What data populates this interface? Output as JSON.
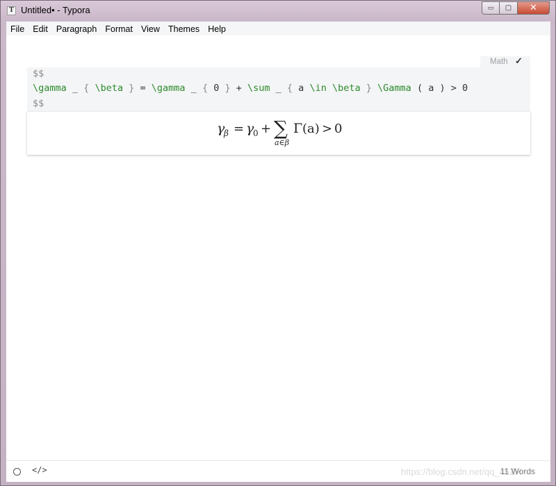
{
  "window": {
    "app_icon": "T",
    "title": "Untitled• - Typora",
    "controls": {
      "minimize": "▭",
      "maximize": "▢",
      "close": "✕"
    }
  },
  "menubar": {
    "items": [
      "File",
      "Edit",
      "Paragraph",
      "Format",
      "View",
      "Themes",
      "Help"
    ]
  },
  "editor": {
    "math_block": {
      "tag_label": "Math",
      "tag_check": "✓",
      "open_delimiter": "$$",
      "close_delimiter": "$$",
      "source_tokens": [
        {
          "t": "\\gamma",
          "k": "cmd"
        },
        {
          "t": " _ ",
          "k": "text"
        },
        {
          "t": "{",
          "k": "brace"
        },
        {
          "t": " ",
          "k": "text"
        },
        {
          "t": "\\beta",
          "k": "cmd"
        },
        {
          "t": " ",
          "k": "text"
        },
        {
          "t": "}",
          "k": "brace"
        },
        {
          "t": " = ",
          "k": "text"
        },
        {
          "t": "\\gamma",
          "k": "cmd"
        },
        {
          "t": " _ ",
          "k": "text"
        },
        {
          "t": "{",
          "k": "brace"
        },
        {
          "t": " 0 ",
          "k": "text"
        },
        {
          "t": "}",
          "k": "brace"
        },
        {
          "t": " + ",
          "k": "text"
        },
        {
          "t": "\\sum",
          "k": "cmd"
        },
        {
          "t": " _ ",
          "k": "text"
        },
        {
          "t": "{",
          "k": "brace"
        },
        {
          "t": " a ",
          "k": "text"
        },
        {
          "t": "\\in",
          "k": "cmd"
        },
        {
          "t": " ",
          "k": "text"
        },
        {
          "t": "\\beta",
          "k": "cmd"
        },
        {
          "t": " ",
          "k": "text"
        },
        {
          "t": "}",
          "k": "brace"
        },
        {
          "t": " ",
          "k": "text"
        },
        {
          "t": "\\Gamma",
          "k": "cmd"
        },
        {
          "t": " ( a ) > 0",
          "k": "text"
        }
      ],
      "rendered": {
        "gamma": "γ",
        "beta_sub": "β",
        "equals": "=",
        "zero_sub": "0",
        "plus": "+",
        "sum": "∑",
        "sum_sub": "a∈β",
        "Gamma": "Γ",
        "paren_a": "(a)",
        "gt": ">",
        "zero": "0"
      }
    }
  },
  "statusbar": {
    "circle_icon": "circle-icon",
    "code_icon": "</>",
    "word_count": "11 Words",
    "watermark": "https://blog.csdn.net/qq_45ZH"
  },
  "colors": {
    "cmd_green": "#2b8a2b",
    "delim_gray": "#8a8a8a",
    "code_bg": "#f4f5f6"
  }
}
